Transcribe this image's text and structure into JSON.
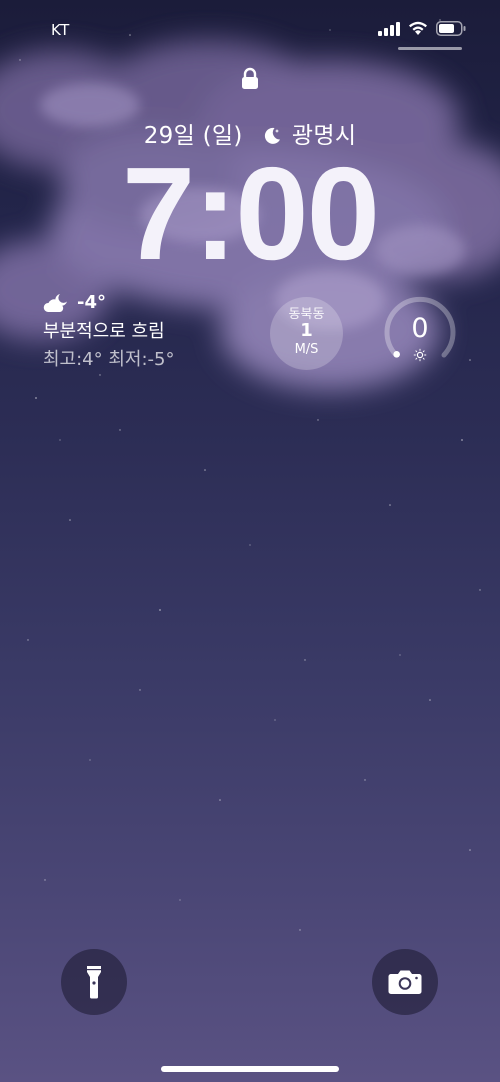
{
  "status_bar": {
    "carrier": "KT",
    "signal_icon": "cellular-signal-icon",
    "wifi_icon": "wifi-icon",
    "battery_icon": "battery-icon"
  },
  "lock": {
    "icon": "lock-icon"
  },
  "date_line": {
    "date": "29일 (일)",
    "moon_icon": "crescent-moon-icon",
    "location": "광명시"
  },
  "clock": {
    "time": "7:00"
  },
  "weather": {
    "icon": "partly-cloudy-night-icon",
    "temperature": "-4°",
    "condition": "부분적으로 흐림",
    "high_low": "최고:4° 최저:-5°"
  },
  "wind": {
    "direction": "동북동",
    "speed": "1",
    "unit": "M/S"
  },
  "uv": {
    "value": "0",
    "level_fraction": 0,
    "icon": "sun-icon"
  },
  "bottom": {
    "flashlight_icon": "flashlight-icon",
    "camera_icon": "camera-icon"
  },
  "colors": {
    "background_top": "#1b1c3a",
    "background_bottom": "#5a5283",
    "cloud": "#8e7fb3"
  }
}
